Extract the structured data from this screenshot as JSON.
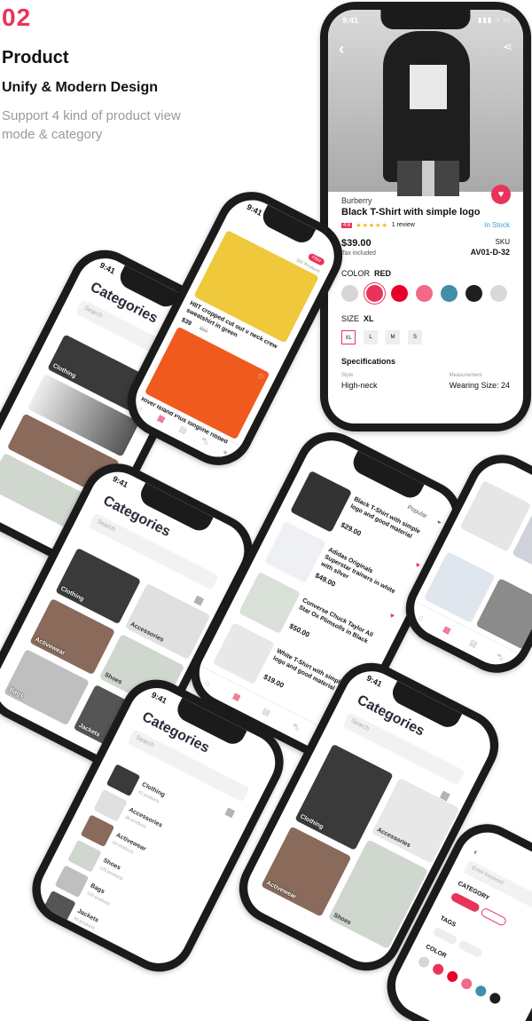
{
  "header": {
    "number": "02",
    "title": "Product",
    "subtitle": "Unify & Modern Design",
    "description": "Support 4 kind of product view mode & category"
  },
  "status": {
    "time": "9:41"
  },
  "product": {
    "brand": "Burberry",
    "name": "Black T-Shirt with simple logo",
    "rating_badge": "4.6",
    "stars": "★★★★★",
    "reviews": "1 review",
    "stock": "In Stock",
    "price": "$39.00",
    "tax": "Tax included",
    "sku_label": "SKU",
    "sku": "AV01-D-32",
    "color_label": "COLOR",
    "color_value": "RED",
    "swatches": [
      "#d6d6d6",
      "#e8345a",
      "#e8002d",
      "#f26a86",
      "#3f8fa8",
      "#1e1e1e",
      "#d9d9d9"
    ],
    "selected_swatch": 1,
    "size_label": "SIZE",
    "size_value": "XL",
    "sizes": [
      "XL",
      "L",
      "M",
      "S"
    ],
    "specs_title": "Specifications",
    "spec_style_label": "Style",
    "spec_style_value": "High-neck",
    "spec_measure_label": "Measurement",
    "spec_measure_value": "Wearing Size: 24",
    "accent": "#e8345a"
  },
  "categories_screen": {
    "title": "Categories",
    "search_placeholder": "Search",
    "items": [
      {
        "label": "Clothing",
        "sub": "42 products"
      },
      {
        "label": "Accessories",
        "sub": "86 products"
      },
      {
        "label": "Activewear",
        "sub": "64 products"
      },
      {
        "label": "Shoes",
        "sub": "120 products"
      },
      {
        "label": "Bags",
        "sub": "100 products"
      },
      {
        "label": "Jackets",
        "sub": "60 products"
      }
    ]
  },
  "listing": {
    "count": "395 Products",
    "item1": {
      "name": "HIIT cropped cut out v neck crew sweatshirt in green",
      "price": "$39",
      "old": "$59"
    },
    "item2": {
      "name": "River Island Plus longline ribbed"
    }
  },
  "product_list": {
    "sort": "Popular",
    "items": [
      {
        "name": "Black T-Shirt with simple logo and good material",
        "price": "$29.00"
      },
      {
        "name": "Adidas Originals Superstar trainers in white with silver",
        "price": "$49.00"
      },
      {
        "name": "Converse Chuck Taylor All Star Ox Plimsolls in Black",
        "price": "$50.00"
      },
      {
        "name": "White T-Shirt with simple logo and good material",
        "price": "$19.00"
      }
    ]
  },
  "filter": {
    "search_placeholder": "Enter Keyword",
    "category_label": "CATEGORY",
    "tags_label": "TAGS",
    "color_label": "COLOR"
  }
}
